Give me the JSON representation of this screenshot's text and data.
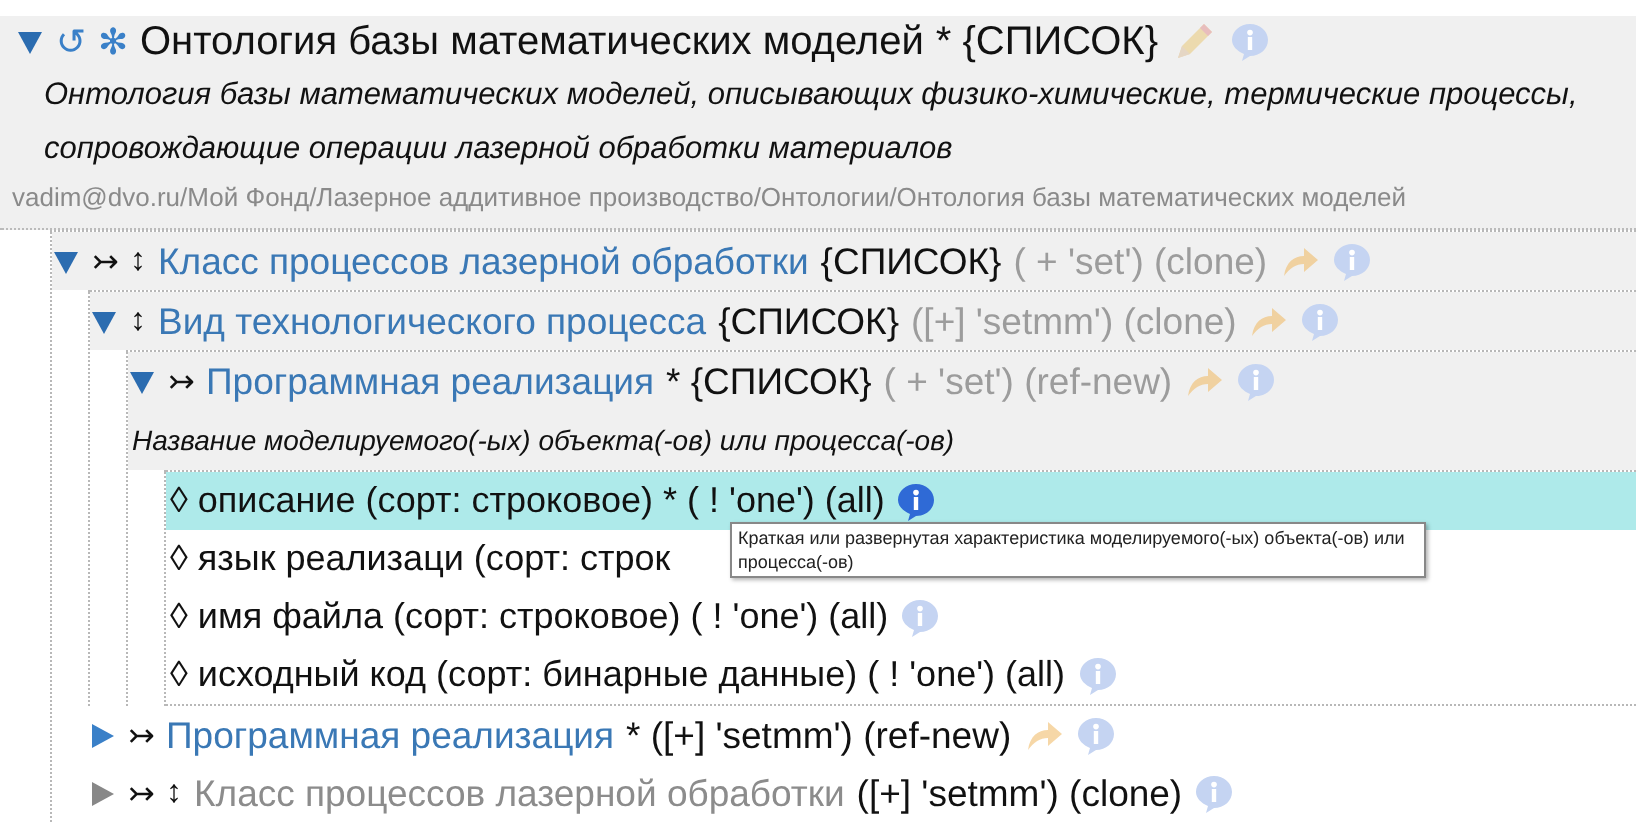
{
  "root": {
    "expanded": true,
    "markers": [
      "↺",
      "✻"
    ],
    "title": "Онтология базы математических моделей",
    "suffix": "* {СПИСОК}",
    "edit_icon": true,
    "info_icon": true,
    "description": "Онтология базы математических моделей, описывающих физико-химические, термические процессы, сопровождающие операции лазерной обработки материалов",
    "path": "vadim@dvo.ru/Мой Фонд/Лазерное аддитивное производство/Онтологии/Онтология базы математических моделей",
    "children": [
      {
        "expanded": true,
        "disabled": false,
        "markers": [
          "↣",
          "↕"
        ],
        "title": "Класс процессов лазерной обработки",
        "suffix": "{СПИСОК}",
        "options": "( + 'set') (clone)",
        "options_faded": true,
        "link_icon": true,
        "info_icon": true,
        "children": [
          {
            "expanded": true,
            "disabled": false,
            "markers": [
              "↕"
            ],
            "title": "Вид технологического процесса",
            "suffix": "{СПИСОК}",
            "options": "([+] 'setmm') (clone)",
            "options_faded": true,
            "link_icon": true,
            "info_icon": true,
            "children": [
              {
                "expanded": true,
                "disabled": false,
                "markers": [
                  "↣"
                ],
                "title": "Программная реализация",
                "suffix": "* {СПИСОК}",
                "options": "( + 'set') (ref-new)",
                "options_faded": true,
                "link_icon": true,
                "info_icon": true,
                "caption": "Название моделируемого(-ых) объекта(-ов) или процесса(-ов)",
                "fields": [
                  {
                    "text": "◊ описание (сорт: строковое) * ( ! 'one') (all)",
                    "selected": true,
                    "info_icon": true
                  },
                  {
                    "text": "◊ язык реализаци (сорт: строк",
                    "selected": false,
                    "info_icon": false
                  },
                  {
                    "text": "◊ имя файла (сорт: строковое) ( ! 'one') (all)",
                    "selected": false,
                    "info_icon": true
                  },
                  {
                    "text": "◊ исходный код (сорт: бинарные данные) ( ! 'one') (all)",
                    "selected": false,
                    "info_icon": true
                  }
                ]
              }
            ]
          },
          {
            "expanded": false,
            "disabled": false,
            "markers": [
              "↣"
            ],
            "title": "Программная реализация",
            "suffix": "* ([+] 'setmm') (ref-new)",
            "link_icon": true,
            "info_icon": true
          },
          {
            "expanded": false,
            "disabled": true,
            "markers": [
              "↣",
              "↕"
            ],
            "title": "Класс процессов лазерной обработки",
            "suffix": "([+] 'setmm') (clone)",
            "link_icon": false,
            "info_icon": true
          }
        ]
      }
    ]
  },
  "tooltip": {
    "text": "Краткая или развернутая характеристика моделируемого(-ых) объекта(-ов) или процесса(-ов)"
  }
}
